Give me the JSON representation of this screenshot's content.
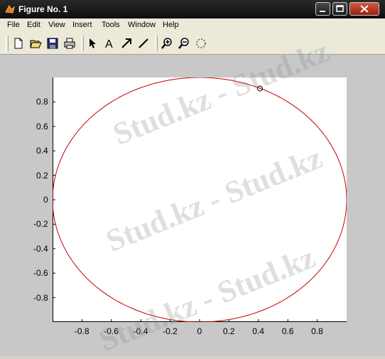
{
  "window": {
    "title": "Figure No. 1"
  },
  "menu": [
    "File",
    "Edit",
    "View",
    "Insert",
    "Tools",
    "Window",
    "Help"
  ],
  "toolbar": [
    {
      "name": "new-figure-icon"
    },
    {
      "name": "open-file-icon"
    },
    {
      "name": "save-icon"
    },
    {
      "name": "print-icon"
    },
    {
      "name": "select-arrow-icon"
    },
    {
      "name": "insert-text-icon"
    },
    {
      "name": "insert-arrow-icon"
    },
    {
      "name": "insert-line-icon"
    },
    {
      "name": "zoom-in-icon"
    },
    {
      "name": "zoom-out-icon"
    },
    {
      "name": "rotate-3d-icon"
    }
  ],
  "chart_data": {
    "type": "line",
    "xlim": [
      -1,
      1
    ],
    "ylim": [
      -1,
      1
    ],
    "xticks": [
      "-0.8",
      "-0.6",
      "-0.4",
      "-0.2",
      "0",
      "0.2",
      "0.4",
      "0.6",
      "0.8"
    ],
    "xtick_values": [
      -0.8,
      -0.6,
      -0.4,
      -0.2,
      0,
      0.2,
      0.4,
      0.6,
      0.8
    ],
    "yticks": [
      "0.8",
      "0.6",
      "0.4",
      "0.2",
      "0",
      "-0.2",
      "-0.4",
      "-0.6",
      "-0.8"
    ],
    "ytick_values": [
      0.8,
      0.6,
      0.4,
      0.2,
      0,
      -0.2,
      -0.4,
      -0.6,
      -0.8
    ],
    "series": [
      {
        "curve": "unit circle x=cos(t), y=sin(t)",
        "color": "#c00000",
        "t_range": [
          0,
          6.2832
        ]
      }
    ],
    "marker": {
      "x": 0.41,
      "y": 0.91,
      "shape": "circle-open"
    },
    "grid": false
  },
  "watermark": {
    "text": "Stud.kz - Stud.kz"
  },
  "colors": {
    "line": "#c00000",
    "figure_bg": "#c8c8c8",
    "titlebar": "#1a1a1a"
  }
}
